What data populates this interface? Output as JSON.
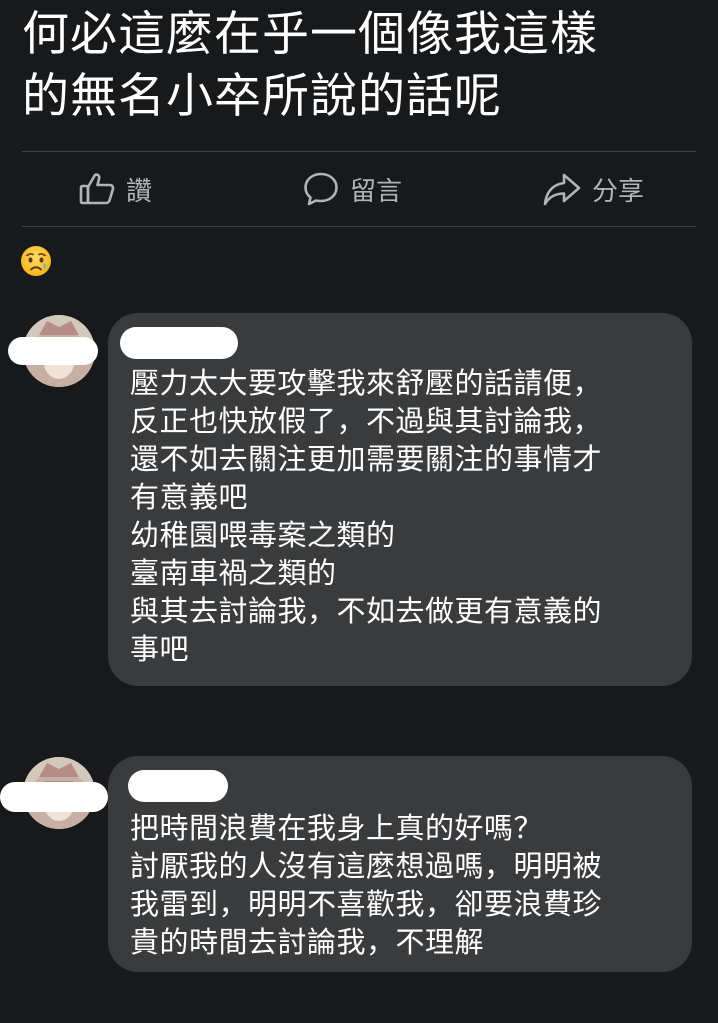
{
  "post": {
    "text": "何必這麼在乎一個像我這樣\n的無名小卒所說的話呢"
  },
  "actions": {
    "like_label": "讚",
    "comment_label": "留言",
    "share_label": "分享"
  },
  "reaction": {
    "icon": "sad-tear-emoji-icon"
  },
  "comments": [
    {
      "text": "壓力太大要攻擊我來舒壓的話請便，\n反正也快放假了，不過與其討論我，\n還不如去關注更加需要關注的事情才\n有意義吧\n幼稚園喂毒案之類的\n臺南車禍之類的\n與其去討論我，不如去做更有意義的\n事吧"
    },
    {
      "text": "把時間浪費在我身上真的好嗎？\n討厭我的人沒有這麼想過嗎，明明被\n我雷到，明明不喜歡我，卻要浪費珍\n貴的時間去討論我，不理解"
    }
  ],
  "colors": {
    "background": "#18191a",
    "bubble": "#3a3b3c",
    "icon": "#b0b3b8",
    "divider": "#3e4042"
  }
}
